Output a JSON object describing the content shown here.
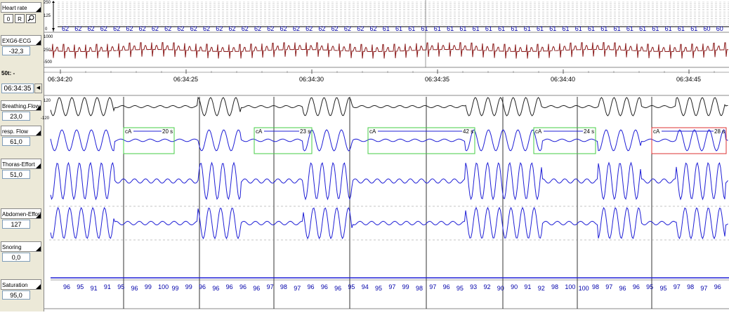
{
  "left_panel": {
    "heart_rate": {
      "label": "Heart rate",
      "scale_top": "250",
      "scale_mid": "125",
      "scale_bottom": "0"
    },
    "buttons": [
      {
        "label": "0"
      },
      {
        "label": "R"
      }
    ],
    "ecg": {
      "label": "EXG6-ECG",
      "value": "-32,3",
      "scale_top": "1000",
      "scale_mid": "250",
      "scale_bottom": "-500"
    },
    "timebase_label": "50t: -",
    "current_time": "06:34:35",
    "breathing_flow": {
      "label": "Breathing.Flow",
      "value": "23,0",
      "scale_top": "120",
      "scale_bottom": "-120"
    },
    "resp_flow": {
      "label": "resp. Flow",
      "value": "61,0"
    },
    "thorax": {
      "label": "Thoras-Effort",
      "value": "51,0"
    },
    "abdomen": {
      "label": "Abdomen-Effort",
      "value": "127"
    },
    "snoring": {
      "label": "Snoring",
      "value": "0,0"
    },
    "saturation": {
      "label": "Saturation",
      "value": "95,0"
    }
  },
  "heart_rate_values": [
    "62",
    "62",
    "62",
    "62",
    "62",
    "62",
    "62",
    "62",
    "62",
    "62",
    "62",
    "62",
    "62",
    "62",
    "62",
    "62",
    "62",
    "62",
    "62",
    "62",
    "62",
    "62",
    "62",
    "62",
    "62",
    "61",
    "61",
    "61",
    "61",
    "61",
    "61",
    "61",
    "61",
    "61",
    "61",
    "61",
    "61",
    "61",
    "61",
    "61",
    "61",
    "61",
    "61",
    "61",
    "61",
    "61",
    "61",
    "61",
    "61",
    "61",
    "60",
    "60"
  ],
  "time_axis": [
    "06:34:20",
    "06:34:25",
    "06:34:30",
    "06:34:35",
    "06:34:40",
    "06:34:45"
  ],
  "events": [
    {
      "label": "cA",
      "duration": "20 s",
      "color": "#44cc44"
    },
    {
      "label": "cA",
      "duration": "23 s",
      "color": "#44cc44"
    },
    {
      "label": "cA",
      "duration": "42 s",
      "color": "#44cc44"
    },
    {
      "label": "cA",
      "duration": "24 s",
      "color": "#44cc44"
    },
    {
      "label": "cA",
      "duration": "28 s",
      "color": "#dd3333"
    }
  ],
  "saturation_values": [
    "96",
    "95",
    "91",
    "91",
    "95",
    "96",
    "99",
    "100",
    "99",
    "99",
    "96",
    "96",
    "96",
    "96",
    "96",
    "97",
    "98",
    "97",
    "96",
    "96",
    "96",
    "95",
    "94",
    "95",
    "97",
    "99",
    "98",
    "97",
    "96",
    "95",
    "93",
    "92",
    "90",
    "90",
    "91",
    "92",
    "98",
    "100",
    "100",
    "98",
    "97",
    "96",
    "96",
    "95",
    "95",
    "97",
    "98",
    "97",
    "96"
  ],
  "colors": {
    "ecg": "#8b1a1a",
    "flow": "#1f1fd6",
    "breathing": "#222222",
    "hr_text": "#0000aa"
  }
}
